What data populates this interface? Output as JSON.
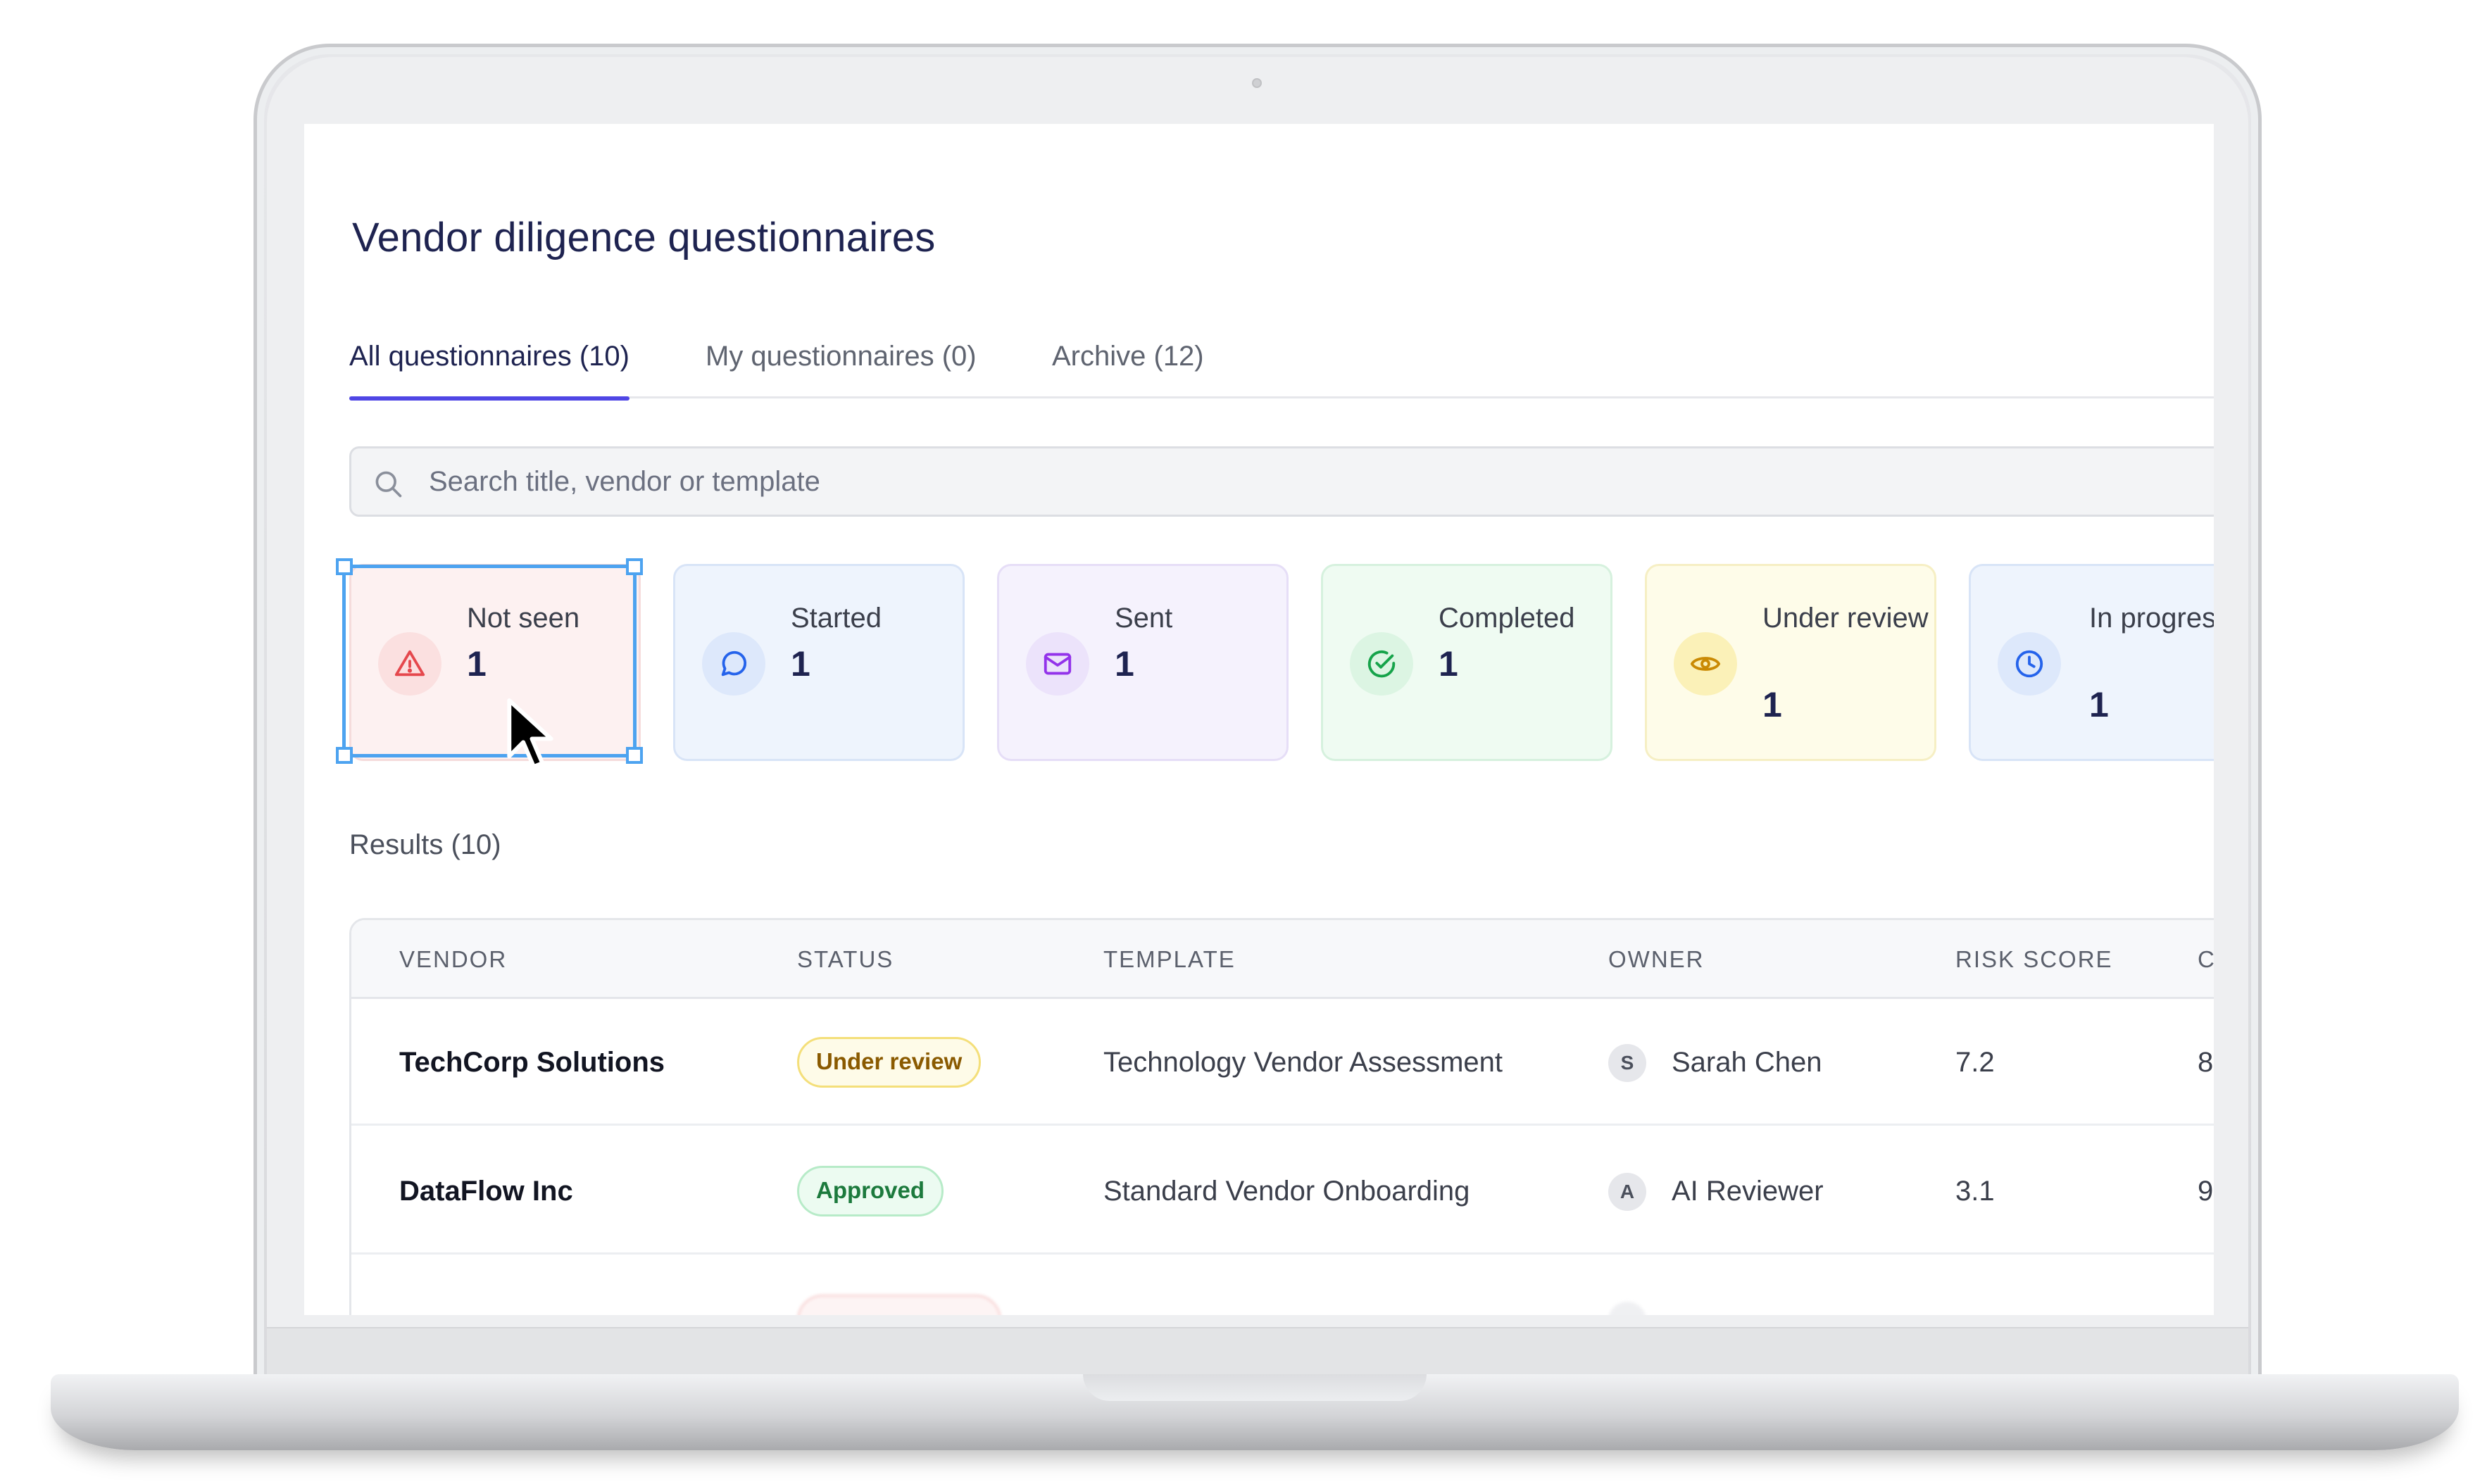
{
  "page": {
    "title": "Vendor diligence questionnaires"
  },
  "tabs": [
    {
      "label": "All questionnaires (10)",
      "active": true
    },
    {
      "label": "My questionnaires (0)",
      "active": false
    },
    {
      "label": "Archive (12)",
      "active": false
    }
  ],
  "search": {
    "placeholder": "Search title, vendor or template",
    "icon": "search-icon"
  },
  "status_cards": [
    {
      "label": "Not seen",
      "count": "1",
      "icon": "alert-triangle-icon",
      "accent": "#e5484d",
      "bg": "#fdf1f1",
      "border": "#f5dcdc",
      "badge_bg": "#fbe0e0"
    },
    {
      "label": "Started",
      "count": "1",
      "icon": "chat-bubble-icon",
      "accent": "#2563eb",
      "bg": "#eef4fd",
      "border": "#d8e4f7",
      "badge_bg": "#dde8fb"
    },
    {
      "label": "Sent",
      "count": "1",
      "icon": "mail-icon",
      "accent": "#9333ea",
      "bg": "#f5f2fd",
      "border": "#e6def7",
      "badge_bg": "#ece3fb"
    },
    {
      "label": "Completed",
      "count": "1",
      "icon": "check-circle-icon",
      "accent": "#16a34a",
      "bg": "#effbf2",
      "border": "#d6f1de",
      "badge_bg": "#dcf5e3"
    },
    {
      "label": "Under review",
      "count": "1",
      "icon": "eye-icon",
      "accent": "#ca8a04",
      "bg": "#fefce9",
      "border": "#f6efc4",
      "badge_bg": "#fbf1b8"
    },
    {
      "label": "In progress",
      "count": "1",
      "icon": "clock-icon",
      "accent": "#2563eb",
      "bg": "#eef4fd",
      "border": "#d8e4f7",
      "badge_bg": "#dde8fb"
    }
  ],
  "results": {
    "label": "Results (10)"
  },
  "table": {
    "columns": [
      "VENDOR",
      "STATUS",
      "TEMPLATE",
      "OWNER",
      "RISK SCORE",
      "C"
    ],
    "rows": [
      {
        "vendor": "TechCorp Solutions",
        "status": "Under review",
        "status_kind": "review",
        "template": "Technology Vendor Assessment",
        "owner_initial": "S",
        "owner": "Sarah Chen",
        "risk_score": "7.2",
        "extra": "8"
      },
      {
        "vendor": "DataFlow Inc",
        "status": "Approved",
        "status_kind": "approved",
        "template": "Standard Vendor Onboarding",
        "owner_initial": "A",
        "owner": "AI Reviewer",
        "risk_score": "3.1",
        "extra": "9"
      }
    ]
  }
}
